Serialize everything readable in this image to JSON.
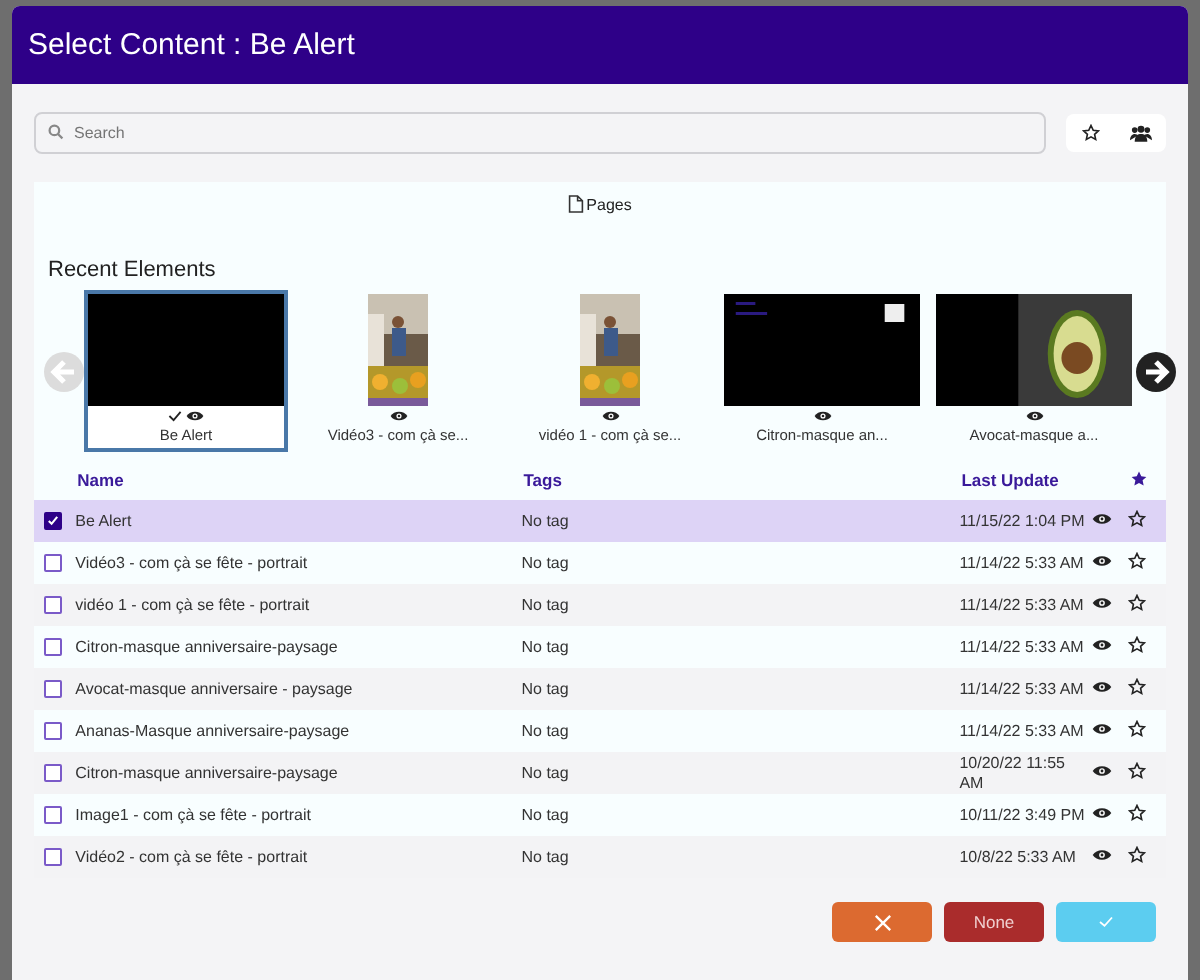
{
  "window": {
    "title": "Select Content : Be Alert"
  },
  "search": {
    "placeholder": "Search"
  },
  "tabs": [
    {
      "label": "Pages",
      "selected": true
    }
  ],
  "recent": {
    "title": "Recent Elements",
    "items": [
      {
        "label": "Be Alert",
        "kind": "black",
        "selected": true
      },
      {
        "label": "Vidéo3 - com çà se...",
        "kind": "portrait",
        "selected": false
      },
      {
        "label": "vidéo 1 - com çà se...",
        "kind": "portrait",
        "selected": false
      },
      {
        "label": "Citron-masque an...",
        "kind": "black",
        "selected": false
      },
      {
        "label": "Avocat-masque a...",
        "kind": "avocado",
        "selected": false
      }
    ]
  },
  "table": {
    "columns": [
      "Name",
      "Tags",
      "Last Update"
    ],
    "rows": [
      {
        "name": "Be Alert",
        "tags": "No tag",
        "updated": "11/15/22 1:04 PM",
        "checked": true
      },
      {
        "name": "Vidéo3 - com çà se fête - portrait",
        "tags": "No tag",
        "updated": "11/14/22 5:33 AM",
        "checked": false
      },
      {
        "name": "vidéo 1 - com çà se fête - portrait",
        "tags": "No tag",
        "updated": "11/14/22 5:33 AM",
        "checked": false
      },
      {
        "name": "Citron-masque anniversaire-paysage",
        "tags": "No tag",
        "updated": "11/14/22 5:33 AM",
        "checked": false
      },
      {
        "name": "Avocat-masque anniversaire - paysage",
        "tags": "No tag",
        "updated": "11/14/22 5:33 AM",
        "checked": false
      },
      {
        "name": "Ananas-Masque anniversaire-paysage",
        "tags": "No tag",
        "updated": "11/14/22 5:33 AM",
        "checked": false
      },
      {
        "name": "Citron-masque anniversaire-paysage",
        "tags": "No tag",
        "updated": "10/20/22 11:55 AM",
        "checked": false
      },
      {
        "name": "Image1 - com çà se fête - portrait",
        "tags": "No tag",
        "updated": "10/11/22 3:49 PM",
        "checked": false
      },
      {
        "name": "Vidéo2 - com çà se fête - portrait",
        "tags": "No tag",
        "updated": "10/8/22 5:33 AM",
        "checked": false
      }
    ]
  },
  "footer": {
    "none_label": "None"
  }
}
